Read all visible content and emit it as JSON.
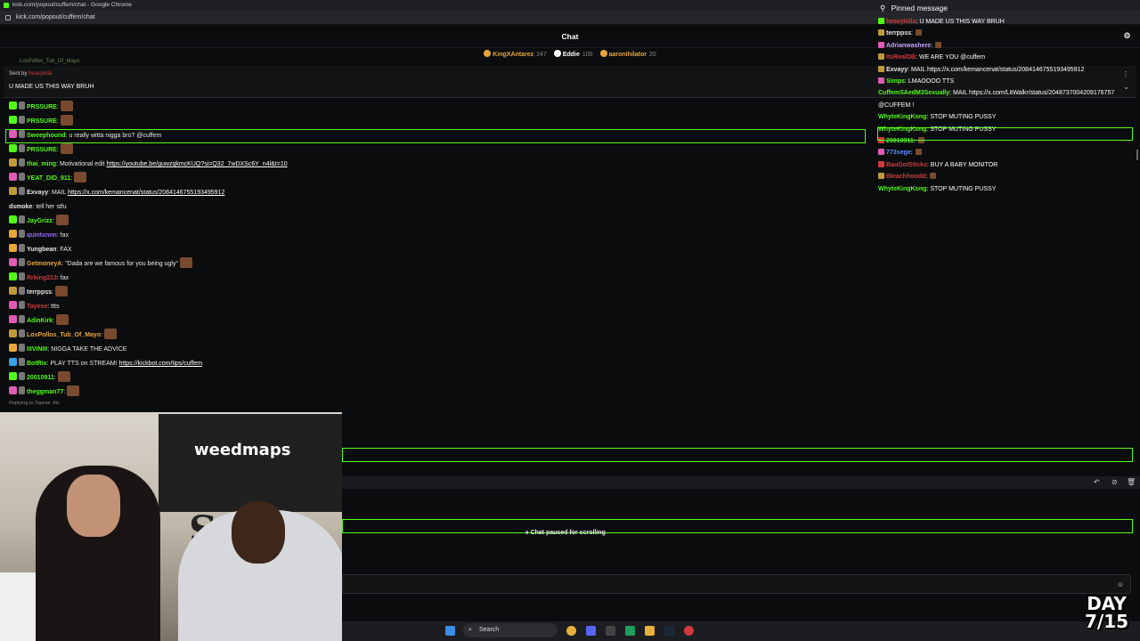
{
  "browser": {
    "title": "kick.com/popout/cuffem/chat - Google Chrome",
    "url": "kick.com/popout/cuffem/chat"
  },
  "header": {
    "title": "Chat",
    "gifters": [
      {
        "name": "KingXAntarez",
        "count": "247",
        "color": "#e8a53a"
      },
      {
        "name": "Eddie",
        "count": "100",
        "color": "#ffffff"
      },
      {
        "name": "aaronihilator",
        "count": "20",
        "color": "#e8a53a"
      }
    ]
  },
  "pinned_left": {
    "sent_by": "Sent by",
    "sender": "heavykilla",
    "message": "U MADE US THIS WAY BRUH",
    "partial_above": "LosPollos_Tub_Of_Mayo:"
  },
  "chat": [
    {
      "user": "PRSSURE",
      "sep": ":",
      "text": "",
      "color": "#53fc18",
      "badge": "#53fc18",
      "emote": true
    },
    {
      "user": "PRSSURE",
      "sep": ":",
      "text": "",
      "color": "#53fc18",
      "badge": "#53fc18",
      "emote": true
    },
    {
      "user": "Sweephound",
      "sep": ":",
      "text": " u really witta nigga bro? @cuffem",
      "color": "#53fc18",
      "badge": "#e05bb5",
      "highlight": true
    },
    {
      "user": "PRSSURE",
      "sep": ":",
      "text": "",
      "color": "#53fc18",
      "badge": "#53fc18",
      "emote": true
    },
    {
      "user": "thai_ming",
      "sep": ":",
      "text": " Motivational edit ",
      "link": "https://youtube.be/guwzqkmcKUQ?si=Q32_7wDXSc6Y_n4l&t=10",
      "color": "#53fc18",
      "badge": "#c09a3a"
    },
    {
      "user": "YEAT_DID_911",
      "sep": ":",
      "text": "",
      "color": "#53fc18",
      "badge": "#e05bb5",
      "emote": true
    },
    {
      "user": "Exvayy",
      "sep": ":",
      "text": " MAIL ",
      "link": "https://x.com/kemancenat/status/2084146755193495912",
      "color": "#e8e8e8",
      "badge": "#c09a3a"
    },
    {
      "user": "dsmoke",
      "sep": ":",
      "text": " tell her stfu",
      "color": "#e8e8e8",
      "badge": ""
    },
    {
      "user": "JayGrizz",
      "sep": ":",
      "text": "",
      "color": "#53fc18",
      "badge": "#53fc18",
      "emote": true
    },
    {
      "user": "quintxnnn",
      "sep": ":",
      "text": " fax",
      "color": "#9b6bff",
      "badge": "#e8a53a"
    },
    {
      "user": "Yungbean",
      "sep": ":",
      "text": " FAX",
      "color": "#e8e8e8",
      "badge": "#e8a53a"
    },
    {
      "user": "GetmoneyA",
      "sep": ":",
      "text": " \"Dada are we famous for you being ugly\"",
      "color": "#e8a53a",
      "badge": "#e05bb5",
      "emote": true
    },
    {
      "user": "Rrking213",
      "sep": ":",
      "text": " fax",
      "color": "#d13b3b",
      "badge": "#53fc18"
    },
    {
      "user": "terrppss",
      "sep": ":",
      "text": "",
      "color": "#e8e8e8",
      "badge": "#c09a3a",
      "emote": true
    },
    {
      "user": "Tayese",
      "sep": ":",
      "text": " ttts",
      "color": "#d13b3b",
      "badge": "#e05bb5"
    },
    {
      "user": "AdinKirk",
      "sep": ":",
      "text": "",
      "color": "#53fc18",
      "badge": "#e05bb5",
      "emote": true
    },
    {
      "user": "LosPollos_Tub_Of_Mayo",
      "sep": ":",
      "text": "",
      "color": "#e8a53a",
      "badge": "#c09a3a",
      "emote": true
    },
    {
      "user": "IIIVINIII",
      "sep": ":",
      "text": " NIGGA TAKE THE ADVICE",
      "color": "#53fc18",
      "badge": "#e8a53a"
    },
    {
      "user": "BotRix",
      "sep": ":",
      "text": " PLAY TTS on STREAM! ",
      "link": "https://kickbot.com/tips/cuffem",
      "color": "#53fc18",
      "badge": "#3aa0e8"
    },
    {
      "user": "20010911",
      "sep": ":",
      "text": "",
      "color": "#53fc18",
      "badge": "#53fc18",
      "emote": true
    },
    {
      "user": "theggman77",
      "sep": ":",
      "text": "",
      "color": "#53fc18",
      "badge": "#e05bb5",
      "emote": true
    }
  ],
  "chat_partial": "Replying to Tayese: ttts",
  "right_overlay": {
    "pinned_label": "Pinned message",
    "messages": [
      {
        "user": "heavykilla",
        "text": " U MADE US THIS WAY BRUH",
        "color": "#d13b3b",
        "badge": "#53fc18"
      },
      {
        "user": "terrppss",
        "text": "",
        "color": "#e8e8e8",
        "badge": "#c09a3a",
        "emote": true
      },
      {
        "user": "Adrianwashere",
        "text": "",
        "color": "#c9a4ff",
        "badge": "#e05bb5",
        "emote": true
      },
      {
        "user": "ItsRealDB",
        "text": " WE ARE YOU @cuffem",
        "color": "#d13b3b",
        "badge": "#c09a3a"
      },
      {
        "user": "Exvayy",
        "text": " MAIL https://x.com/kemancenat/status/2084146755193495912",
        "color": "#e8e8e8",
        "badge": "#c09a3a"
      },
      {
        "user": "Simps",
        "text": " LMAOOOO TTS",
        "color": "#53fc18",
        "badge": "#e05bb5"
      },
      {
        "user": "CuffemSAedM3Sexually",
        "text": " MAIL https://x.com/LitWalkr/status/2048737004209176757 @CUFFEM !",
        "color": "#53fc18",
        "badge": "",
        "wrap": true
      },
      {
        "user": "WhyteKingKong",
        "text": " STOP MUTING PUSSY",
        "color": "#53fc18",
        "badge": ""
      },
      {
        "user": "WhyteKingKong",
        "text": " STOP MUTING PUSSY",
        "color": "#53fc18",
        "badge": ""
      },
      {
        "user": "20010911",
        "text": "",
        "color": "#53fc18",
        "badge": "#d13b3b",
        "emote": true
      },
      {
        "user": "773sege",
        "text": "",
        "color": "#5b8bff",
        "badge": "#e05bb5",
        "emote": true
      },
      {
        "user": "BauGotSticks",
        "text": " BUY A BABY MONITOR",
        "color": "#d13b3b",
        "badge": "#d13b3b"
      },
      {
        "user": "Bleachhoodd",
        "text": "",
        "color": "#d13b3b",
        "badge": "#c09a3a",
        "emote": true
      },
      {
        "user": "WhyteKingKong",
        "text": " STOP MUTING PUSSY",
        "color": "#53fc18",
        "badge": ""
      }
    ]
  },
  "status": {
    "paused": "Chat paused for scrolling"
  },
  "taskbar": {
    "search": "Search"
  },
  "overlay": {
    "day_line1": "DAY",
    "day_line2": "7/15"
  },
  "webcam": {
    "banner_text": "weedmaps",
    "stage_text": "Sta"
  },
  "colors": {
    "accent": "#53fc18",
    "background": "#0b0c0e"
  }
}
